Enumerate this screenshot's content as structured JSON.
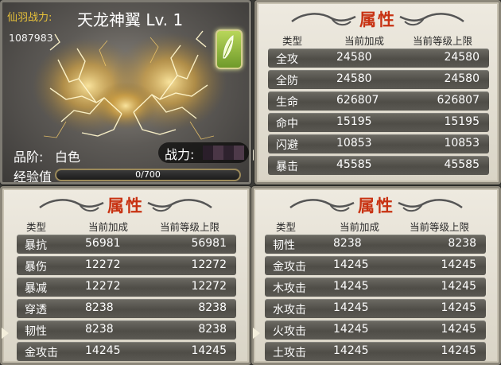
{
  "card": {
    "power_label": "仙羽战力:",
    "power_value": "1087983",
    "name": "天龙神翼 Lv. 1",
    "quality_label": "品阶:",
    "quality_value": "白色",
    "combat_label": "战力:",
    "exp_label": "经验值",
    "exp_text": "0/700",
    "exp_progress": 0,
    "badge_icon": "feather-icon"
  },
  "panels": [
    {
      "title": "属性",
      "columns": [
        "类型",
        "当前加成",
        "当前等级上限"
      ],
      "rows": [
        {
          "name": "全攻",
          "current": "24580",
          "max": "24580"
        },
        {
          "name": "全防",
          "current": "24580",
          "max": "24580"
        },
        {
          "name": "生命",
          "current": "626807",
          "max": "626807"
        },
        {
          "name": "命中",
          "current": "15195",
          "max": "15195"
        },
        {
          "name": "闪避",
          "current": "10853",
          "max": "10853"
        },
        {
          "name": "暴击",
          "current": "45585",
          "max": "45585"
        }
      ]
    },
    {
      "title": "属性",
      "columns": [
        "类型",
        "当前加成",
        "当前等级上限"
      ],
      "rows": [
        {
          "name": "暴抗",
          "current": "56981",
          "max": "56981"
        },
        {
          "name": "暴伤",
          "current": "12272",
          "max": "12272"
        },
        {
          "name": "暴减",
          "current": "12272",
          "max": "12272"
        },
        {
          "name": "穿透",
          "current": "8238",
          "max": "8238"
        },
        {
          "name": "韧性",
          "current": "8238",
          "max": "8238"
        },
        {
          "name": "金攻击",
          "current": "14245",
          "max": "14245"
        }
      ]
    },
    {
      "title": "属性",
      "columns": [
        "类型",
        "当前加成",
        "当前等级上限"
      ],
      "rows": [
        {
          "name": "韧性",
          "current": "8238",
          "max": "8238"
        },
        {
          "name": "金攻击",
          "current": "14245",
          "max": "14245"
        },
        {
          "name": "木攻击",
          "current": "14245",
          "max": "14245"
        },
        {
          "name": "水攻击",
          "current": "14245",
          "max": "14245"
        },
        {
          "name": "火攻击",
          "current": "14245",
          "max": "14245"
        },
        {
          "name": "土攻击",
          "current": "14245",
          "max": "14245"
        }
      ]
    }
  ]
}
